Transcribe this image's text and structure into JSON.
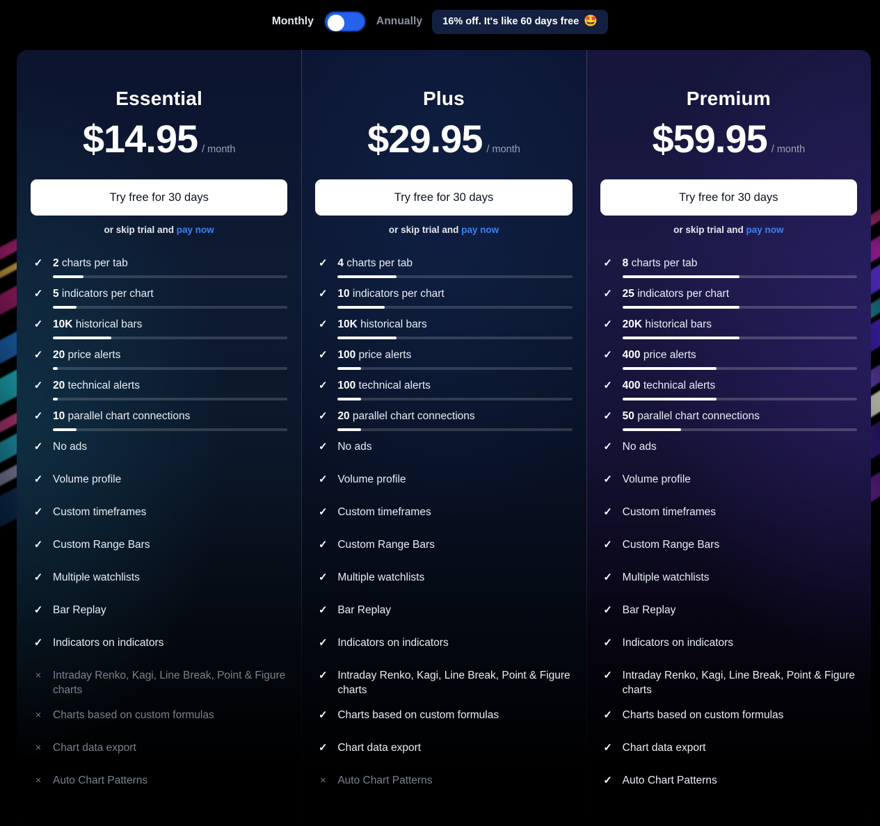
{
  "billing_toggle": {
    "monthly_label": "Monthly",
    "annually_label": "Annually",
    "selected": "Monthly",
    "promo_badge": "16% off. It's like 60 days free",
    "promo_emoji": "🤩",
    "accent_color": "#2563eb",
    "badge_bg": "#132040"
  },
  "cta_shared": {
    "button_label": "Try free for 30 days",
    "skip_prefix": "or skip trial and ",
    "skip_link": "pay now",
    "link_color": "#3b82f6",
    "per_period": "/ month"
  },
  "plans": [
    {
      "name": "Essential",
      "price": "$14.95",
      "per": "/ month",
      "cta": "Try free for 30 days",
      "skip_prefix": "or skip trial and ",
      "skip_link": "pay now",
      "features": [
        {
          "qty": "2",
          "text": " charts per tab",
          "state": "check",
          "bar": 13
        },
        {
          "qty": "5",
          "text": " indicators per chart",
          "state": "check",
          "bar": 10
        },
        {
          "qty": "10K",
          "text": " historical bars",
          "state": "check",
          "bar": 25
        },
        {
          "qty": "20",
          "text": " price alerts",
          "state": "check",
          "bar": 2
        },
        {
          "qty": "20",
          "text": " technical alerts",
          "state": "check",
          "bar": 2
        },
        {
          "qty": "10",
          "text": " parallel chart connections",
          "state": "check",
          "bar": 10
        },
        {
          "qty": "",
          "text": "No ads",
          "state": "check",
          "bar": null
        },
        {
          "qty": "",
          "text": "Volume profile",
          "state": "check",
          "bar": null
        },
        {
          "qty": "",
          "text": "Custom timeframes",
          "state": "check",
          "bar": null
        },
        {
          "qty": "",
          "text": "Custom Range Bars",
          "state": "check",
          "bar": null
        },
        {
          "qty": "",
          "text": "Multiple watchlists",
          "state": "check",
          "bar": null
        },
        {
          "qty": "",
          "text": "Bar Replay",
          "state": "check",
          "bar": null
        },
        {
          "qty": "",
          "text": "Indicators on indicators",
          "state": "check",
          "bar": null
        },
        {
          "qty": "",
          "text": "Intraday Renko, Kagi, Line Break, Point & Figure charts",
          "state": "cross",
          "bar": null
        },
        {
          "qty": "",
          "text": "Charts based on custom formulas",
          "state": "cross",
          "bar": null
        },
        {
          "qty": "",
          "text": "Chart data export",
          "state": "cross",
          "bar": null
        },
        {
          "qty": "",
          "text": "Auto Chart Patterns",
          "state": "cross",
          "bar": null
        }
      ]
    },
    {
      "name": "Plus",
      "price": "$29.95",
      "per": "/ month",
      "cta": "Try free for 30 days",
      "skip_prefix": "or skip trial and ",
      "skip_link": "pay now",
      "features": [
        {
          "qty": "4",
          "text": " charts per tab",
          "state": "check",
          "bar": 25
        },
        {
          "qty": "10",
          "text": " indicators per chart",
          "state": "check",
          "bar": 20
        },
        {
          "qty": "10K",
          "text": " historical bars",
          "state": "check",
          "bar": 25
        },
        {
          "qty": "100",
          "text": " price alerts",
          "state": "check",
          "bar": 10
        },
        {
          "qty": "100",
          "text": " technical alerts",
          "state": "check",
          "bar": 10
        },
        {
          "qty": "20",
          "text": " parallel chart connections",
          "state": "check",
          "bar": 10
        },
        {
          "qty": "",
          "text": "No ads",
          "state": "check",
          "bar": null
        },
        {
          "qty": "",
          "text": "Volume profile",
          "state": "check",
          "bar": null
        },
        {
          "qty": "",
          "text": "Custom timeframes",
          "state": "check",
          "bar": null
        },
        {
          "qty": "",
          "text": "Custom Range Bars",
          "state": "check",
          "bar": null
        },
        {
          "qty": "",
          "text": "Multiple watchlists",
          "state": "check",
          "bar": null
        },
        {
          "qty": "",
          "text": "Bar Replay",
          "state": "check",
          "bar": null
        },
        {
          "qty": "",
          "text": "Indicators on indicators",
          "state": "check",
          "bar": null
        },
        {
          "qty": "",
          "text": "Intraday Renko, Kagi, Line Break, Point & Figure charts",
          "state": "check",
          "bar": null
        },
        {
          "qty": "",
          "text": "Charts based on custom formulas",
          "state": "check",
          "bar": null
        },
        {
          "qty": "",
          "text": "Chart data export",
          "state": "check",
          "bar": null
        },
        {
          "qty": "",
          "text": "Auto Chart Patterns",
          "state": "cross",
          "bar": null
        }
      ]
    },
    {
      "name": "Premium",
      "price": "$59.95",
      "per": "/ month",
      "cta": "Try free for 30 days",
      "skip_prefix": "or skip trial and ",
      "skip_link": "pay now",
      "features": [
        {
          "qty": "8",
          "text": " charts per tab",
          "state": "check",
          "bar": 50
        },
        {
          "qty": "25",
          "text": " indicators per chart",
          "state": "check",
          "bar": 50
        },
        {
          "qty": "20K",
          "text": " historical bars",
          "state": "check",
          "bar": 50
        },
        {
          "qty": "400",
          "text": " price alerts",
          "state": "check",
          "bar": 40
        },
        {
          "qty": "400",
          "text": " technical alerts",
          "state": "check",
          "bar": 40
        },
        {
          "qty": "50",
          "text": " parallel chart connections",
          "state": "check",
          "bar": 25
        },
        {
          "qty": "",
          "text": "No ads",
          "state": "check",
          "bar": null
        },
        {
          "qty": "",
          "text": "Volume profile",
          "state": "check",
          "bar": null
        },
        {
          "qty": "",
          "text": "Custom timeframes",
          "state": "check",
          "bar": null
        },
        {
          "qty": "",
          "text": "Custom Range Bars",
          "state": "check",
          "bar": null
        },
        {
          "qty": "",
          "text": "Multiple watchlists",
          "state": "check",
          "bar": null
        },
        {
          "qty": "",
          "text": "Bar Replay",
          "state": "check",
          "bar": null
        },
        {
          "qty": "",
          "text": "Indicators on indicators",
          "state": "check",
          "bar": null
        },
        {
          "qty": "",
          "text": "Intraday Renko, Kagi, Line Break, Point & Figure charts",
          "state": "check",
          "bar": null
        },
        {
          "qty": "",
          "text": "Charts based on custom formulas",
          "state": "check",
          "bar": null
        },
        {
          "qty": "",
          "text": "Chart data export",
          "state": "check",
          "bar": null
        },
        {
          "qty": "",
          "text": "Auto Chart Patterns",
          "state": "check",
          "bar": null
        }
      ]
    }
  ],
  "icons": {
    "check": "✓",
    "cross": "×"
  }
}
